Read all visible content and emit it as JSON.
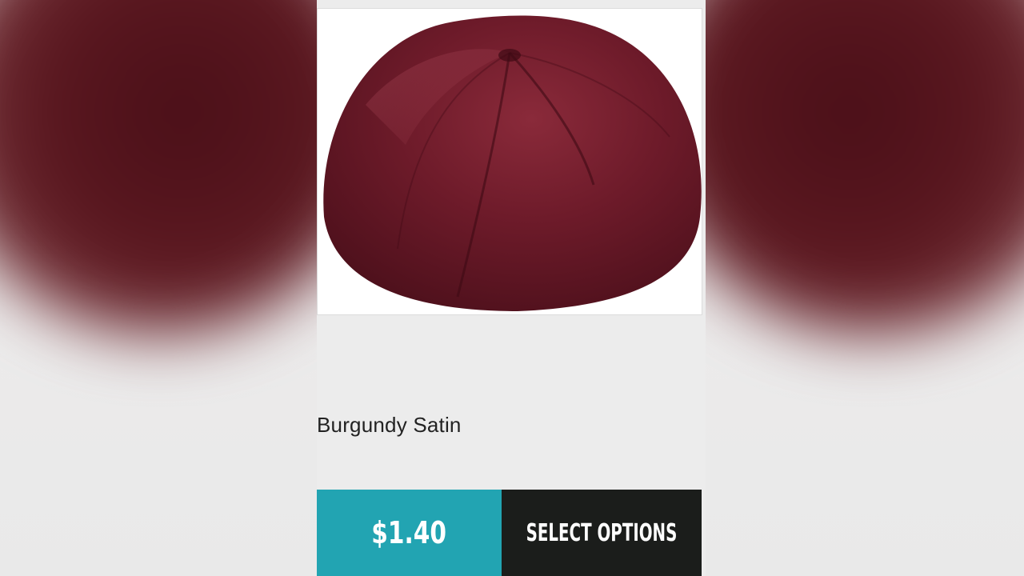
{
  "product": {
    "image_alt": "burgundy satin kippah",
    "name": "Burgundy Satin",
    "price": "$1.40",
    "select_label": "SELECT OPTIONS"
  },
  "colors": {
    "product": "#6b1a26",
    "price_bg": "#22a4b2",
    "button_bg": "#1b1d1b"
  }
}
